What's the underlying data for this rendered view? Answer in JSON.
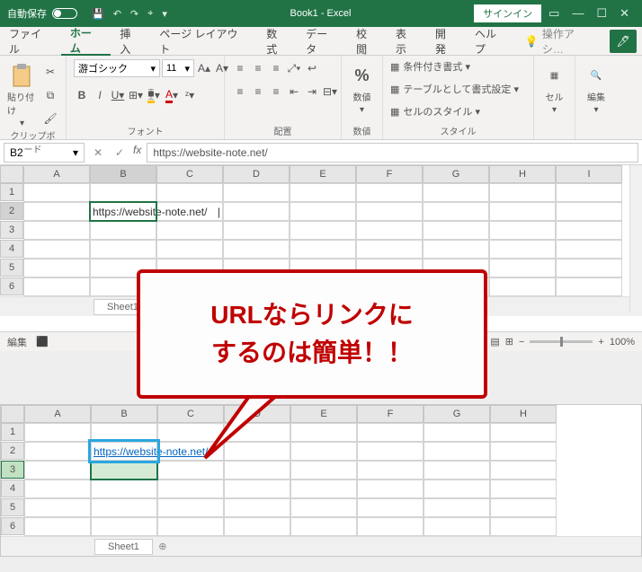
{
  "titlebar": {
    "autosave": "自動保存",
    "book": "Book1",
    "app": "Excel",
    "signin": "サインイン"
  },
  "tabs": {
    "file": "ファイル",
    "home": "ホーム",
    "insert": "挿入",
    "layout": "ページ レイアウト",
    "formulas": "数式",
    "data": "データ",
    "review": "校閲",
    "view": "表示",
    "developer": "開発",
    "help": "ヘルプ",
    "search": "操作アシ…"
  },
  "ribbon": {
    "paste": "貼り付け",
    "clipboard_label": "クリップボード",
    "font_name": "游ゴシック",
    "font_size": "11",
    "font_label": "フォント",
    "align_label": "配置",
    "number_btn": "数値",
    "number_label": "数値",
    "style_cond": "条件付き書式 ▾",
    "style_table": "テーブルとして書式設定 ▾",
    "style_cell": "セルのスタイル ▾",
    "style_label": "スタイル",
    "cells_btn": "セル",
    "edit_btn": "編集"
  },
  "namebar": {
    "ref": "B2",
    "formula": "https://website-note.net/"
  },
  "sheet1": {
    "cols": [
      "A",
      "B",
      "C",
      "D",
      "E",
      "F",
      "G",
      "H",
      "I"
    ],
    "b2": "https://website-note.net/",
    "tab": "Sheet1"
  },
  "sheet2": {
    "cols": [
      "A",
      "B",
      "C",
      "D",
      "E",
      "F",
      "G",
      "H"
    ],
    "b2": "https://website-note.net/",
    "tab": "Sheet1"
  },
  "status": {
    "edit": "編集",
    "zoom": "100%"
  },
  "callout": {
    "line1": "URLならリンクに",
    "line2": "するのは簡単！！"
  }
}
